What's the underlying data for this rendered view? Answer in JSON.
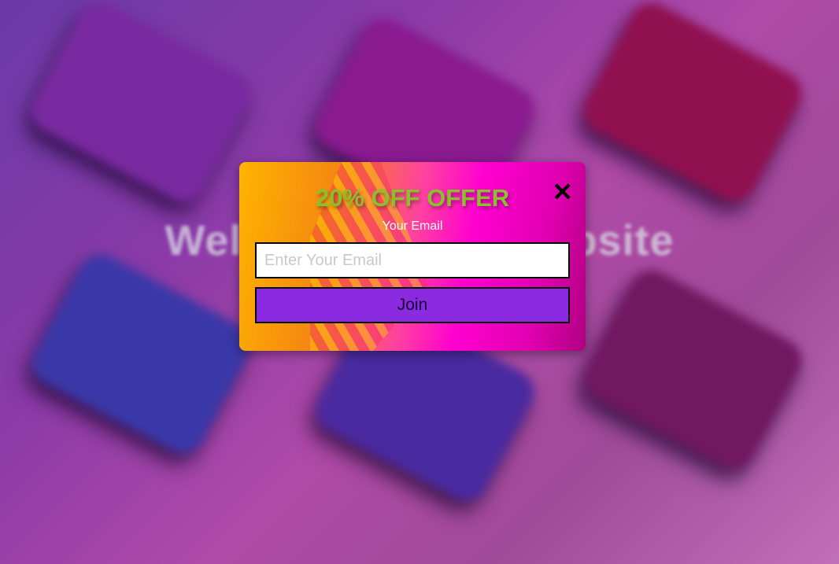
{
  "background": {
    "heading": "Welcome to our Website"
  },
  "popup": {
    "title": "20% OFF OFFER",
    "close_icon": "close-icon",
    "email_label": "Your Email",
    "email_value": "",
    "email_placeholder": "Enter Your Email",
    "join_label": "Join"
  },
  "colors": {
    "title": "#8bbf2e",
    "button": "#8a2be2"
  }
}
